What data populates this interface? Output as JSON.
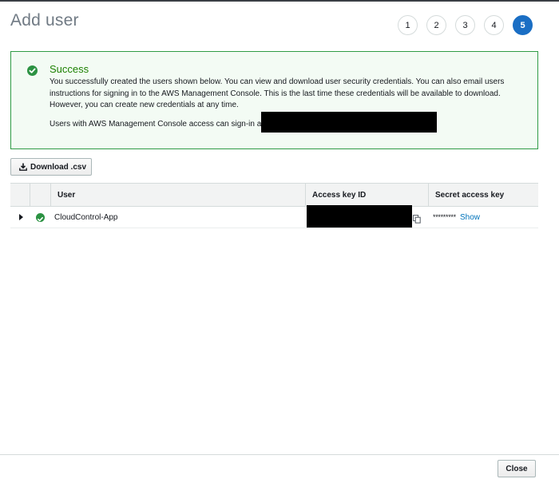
{
  "page": {
    "title": "Add user"
  },
  "steps": {
    "items": [
      "1",
      "2",
      "3",
      "4",
      "5"
    ],
    "active": "5"
  },
  "alert": {
    "title": "Success",
    "body": "You successfully created the users shown below. You can view and download user security credentials. You can also email users instructions for signing in to the AWS Management Console. This is the last time these credentials will be available to download. However, you can create new credentials at any time.",
    "signin_text": "Users with AWS Management Console access can sign-in at:",
    "icon": "check-circle-icon",
    "color": "#1d8102"
  },
  "toolbar": {
    "download_label": "Download .csv",
    "download_icon": "download-icon"
  },
  "table": {
    "headers": {
      "user": "User",
      "access_key": "Access key ID",
      "secret": "Secret access key"
    },
    "rows": [
      {
        "user": "CloudControl-App",
        "secret_mask": "*********",
        "show_label": "Show",
        "status": "success"
      }
    ]
  },
  "footer": {
    "close_label": "Close"
  },
  "colors": {
    "accent": "#1a6ec4",
    "success": "#2b9242",
    "link": "#0073bb"
  }
}
